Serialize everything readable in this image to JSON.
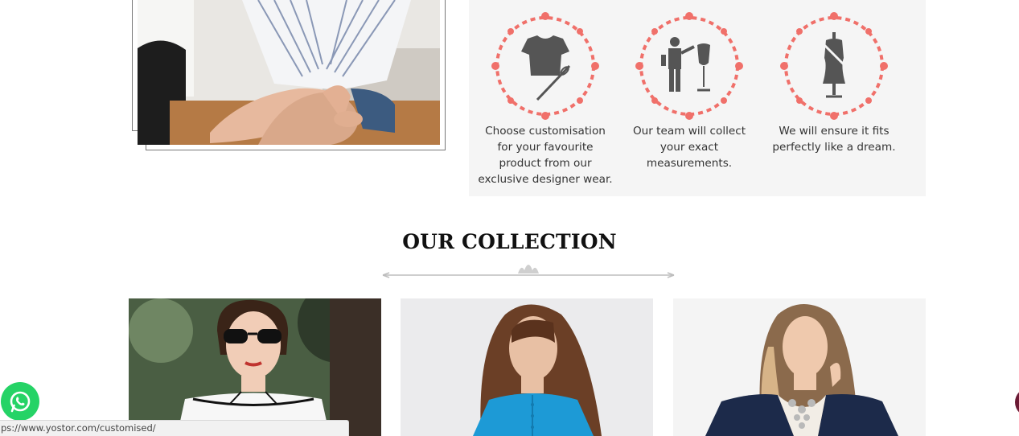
{
  "hero": {
    "image": "woman seated on floor in striped top and denim shorts"
  },
  "steps": [
    {
      "icon": "tshirt-needle-icon",
      "text": "Choose customisation for your favourite product from our exclusive designer wear."
    },
    {
      "icon": "tailor-mannequin-icon",
      "text": "Our team will collect your exact measurements."
    },
    {
      "icon": "dress-form-icon",
      "text": "We will ensure it fits perfectly like a dream."
    }
  ],
  "collection": {
    "title": "OUR COLLECTION",
    "products": [
      {
        "image": "woman in sunglasses and white off-shoulder top"
      },
      {
        "image": "woman in blue pintuck shirt"
      },
      {
        "image": "woman in navy blazer with statement necklace"
      }
    ]
  },
  "whatsapp": {
    "icon": "whatsapp-icon"
  },
  "status_bar": {
    "url": "ps://www.yostor.com/customised/"
  },
  "colors": {
    "ornament": "#f0706a",
    "icon_gray": "#555555",
    "panel_bg": "#f5f5f5",
    "whatsapp": "#25d366"
  }
}
